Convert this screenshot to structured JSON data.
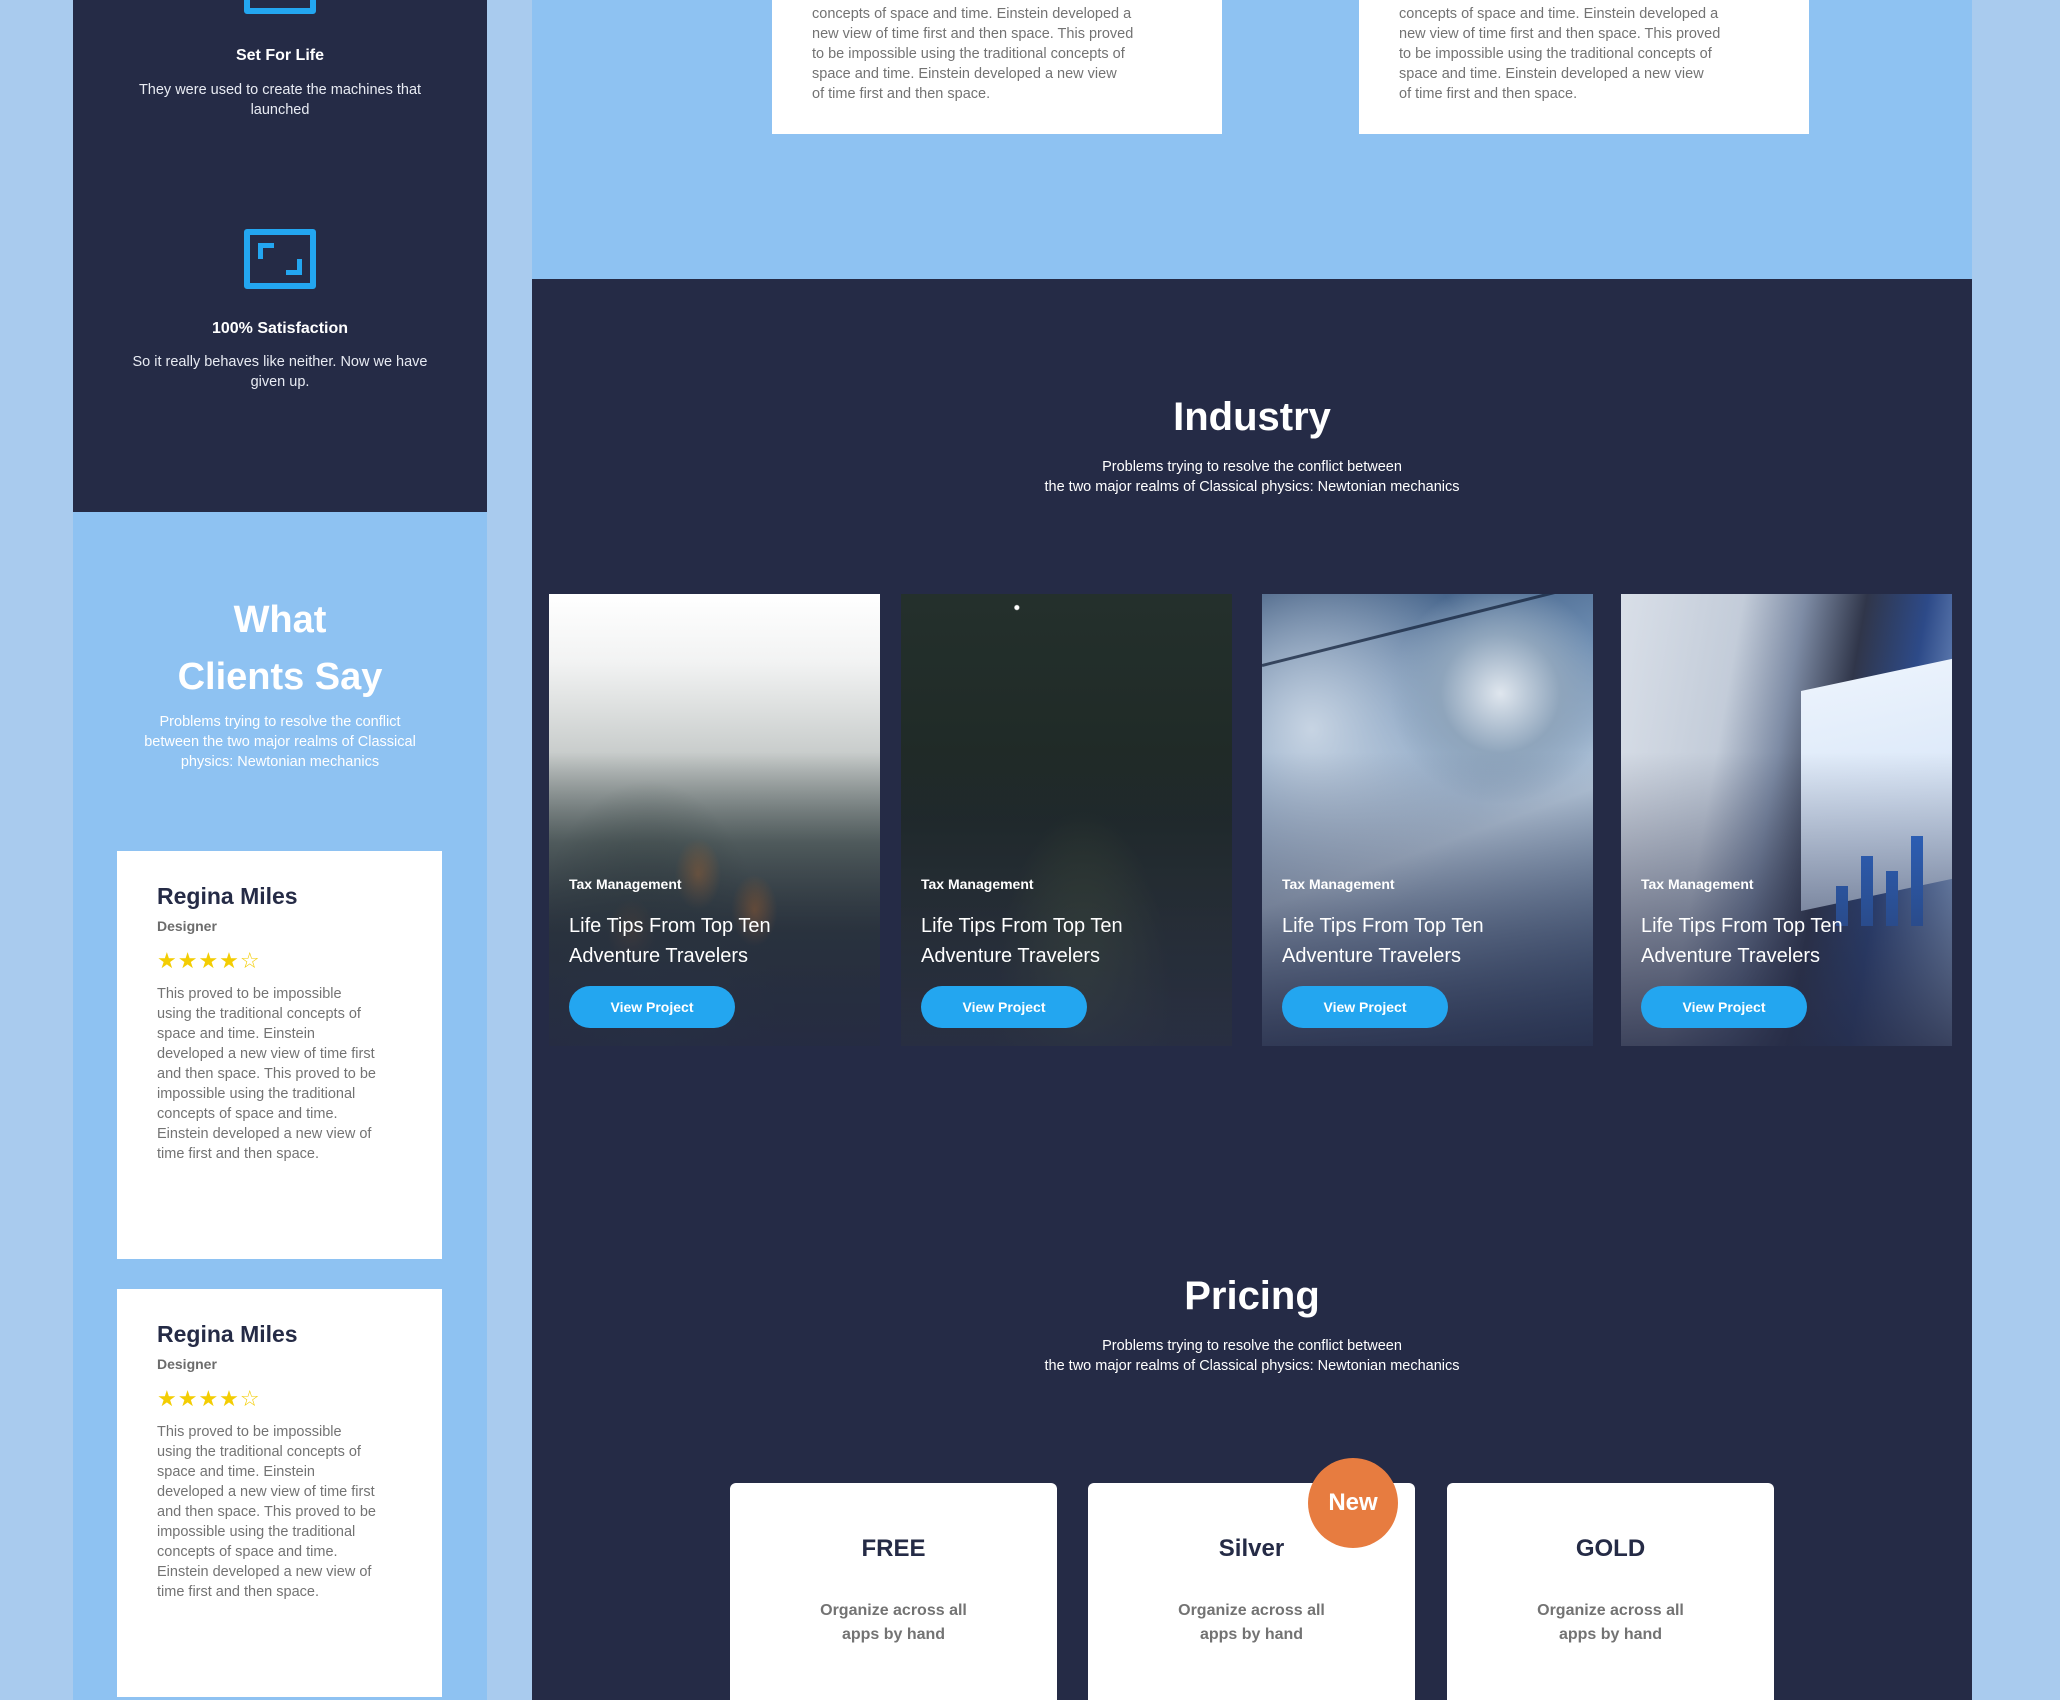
{
  "features": [
    {
      "title": "Set For Life",
      "text": "They were used to create the machines that launched",
      "icon": "frame-icon"
    },
    {
      "title": "100% Satisfaction",
      "text": "So it really behaves like neither. Now we have given up.",
      "icon": "expand-icon"
    }
  ],
  "clients": {
    "title_line1": "What",
    "title_line2": "Clients Say",
    "subtitle": "Problems trying to resolve the conflict between the two major realms of Classical physics: Newtonian mechanics",
    "testimonials": [
      {
        "name": "Regina Miles",
        "role": "Designer",
        "stars": "★★★★☆",
        "rating": 4,
        "text": "This proved to be impossible using the traditional concepts of space and time. Einstein developed a new view of time first and then space. This proved to be impossible using the traditional concepts of space and time. Einstein developed a new view of time first and then space."
      },
      {
        "name": "Regina Miles",
        "role": "Designer",
        "stars": "★★★★☆",
        "rating": 4,
        "text": "This proved to be impossible using the traditional concepts of space and time. Einstein developed a new view of time first and then space. This proved to be impossible using the traditional concepts of space and time. Einstein developed a new view of time first and then space."
      }
    ]
  },
  "top_cards": [
    {
      "line1": "concepts of space and time. Einstein developed a",
      "line2": "new view of time first and then space. This proved",
      "line3": "to be impossible using the traditional concepts of",
      "line4": "space and time. Einstein developed a new view",
      "line5": "of time first and then space."
    },
    {
      "line1": "concepts of space and time. Einstein developed a",
      "line2": "new view of time first and then space. This proved",
      "line3": "to be impossible using the traditional concepts of",
      "line4": "space and time. Einstein developed a new view",
      "line5": "of time first and then space."
    }
  ],
  "industry": {
    "title": "Industry",
    "subtitle_line1": "Problems trying to resolve the conflict between",
    "subtitle_line2": "the two major realms of Classical physics: Newtonian mechanics",
    "cards": [
      {
        "category": "Tax Management",
        "title": "Life Tips From Top Ten Adventure Travelers",
        "button": "View Project",
        "image": "misty-forest"
      },
      {
        "category": "Tax Management",
        "title": "Life Tips From Top Ten Adventure Travelers",
        "button": "View Project",
        "image": "night-sky"
      },
      {
        "category": "Tax Management",
        "title": "Life Tips From Top Ten Adventure Travelers",
        "button": "View Project",
        "image": "coins-on-chart"
      },
      {
        "category": "Tax Management",
        "title": "Life Tips From Top Ten Adventure Travelers",
        "button": "View Project",
        "image": "laptop-charts"
      }
    ]
  },
  "pricing": {
    "title": "Pricing",
    "subtitle_line1": "Problems trying to resolve the conflict between",
    "subtitle_line2": "the two major realms of Classical physics: Newtonian mechanics",
    "badge": "New",
    "plans": [
      {
        "name": "FREE",
        "desc": "Organize across all apps by hand"
      },
      {
        "name": "Silver",
        "desc": "Organize across all apps by hand"
      },
      {
        "name": "GOLD",
        "desc": "Organize across all apps by hand"
      }
    ]
  },
  "colors": {
    "dark": "#252b46",
    "light_blue": "#8ec2f2",
    "accent": "#23a6f0",
    "badge": "#e77c40",
    "star": "#f3cd03"
  }
}
